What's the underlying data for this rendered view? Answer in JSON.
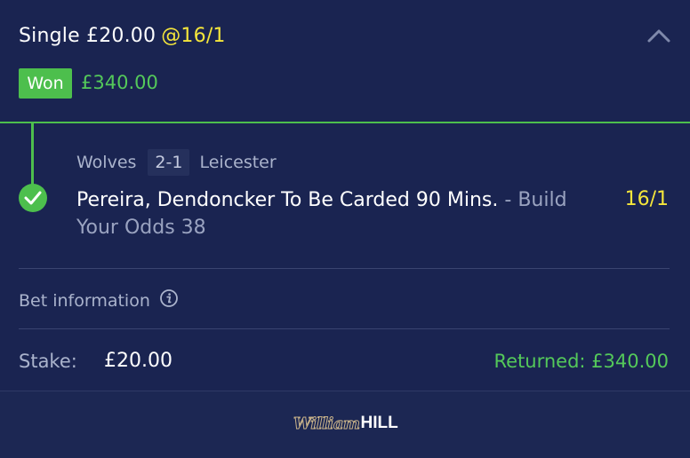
{
  "bet": {
    "type_stake": "Single £20.00",
    "odds": "@16/1",
    "status": "Won",
    "win_amount": "£340.00"
  },
  "selection": {
    "home_team": "Wolves",
    "score": "2-1",
    "away_team": "Leicester",
    "name": "Pereira, Dendoncker To Be Carded 90 Mins.",
    "separator": "-",
    "market": "Build Your Odds 38",
    "odds": "16/1"
  },
  "bet_info": {
    "label": "Bet information"
  },
  "summary": {
    "stake_label": "Stake:",
    "stake_value": "£20.00",
    "returned": "Returned: £340.00"
  },
  "footer": {
    "logo_william": "William",
    "logo_hill": "HILL"
  },
  "colors": {
    "background": "#1a2451",
    "win_green": "#4dbf4d",
    "odds_yellow": "#f5e63b"
  },
  "icons": {
    "collapse": "chevron-up-icon",
    "settled": "checkmark-icon",
    "info": "info-icon"
  }
}
